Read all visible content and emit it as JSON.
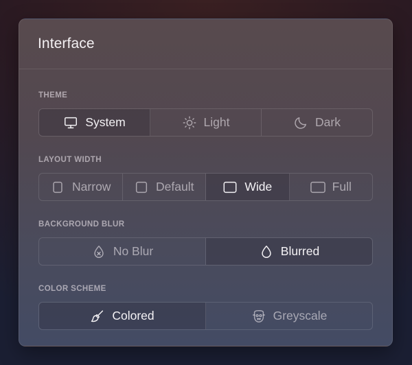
{
  "panel": {
    "title": "Interface"
  },
  "theme": {
    "label": "THEME",
    "options": [
      {
        "label": "System",
        "icon": "monitor-icon",
        "selected": true
      },
      {
        "label": "Light",
        "icon": "sun-icon",
        "selected": false
      },
      {
        "label": "Dark",
        "icon": "moon-icon",
        "selected": false
      }
    ]
  },
  "layout_width": {
    "label": "LAYOUT WIDTH",
    "options": [
      {
        "label": "Narrow",
        "icon": "checkbox-icon",
        "selected": false
      },
      {
        "label": "Default",
        "icon": "checkbox-icon",
        "selected": false
      },
      {
        "label": "Wide",
        "icon": "checkbox-icon",
        "selected": true
      },
      {
        "label": "Full",
        "icon": "checkbox-icon",
        "selected": false
      }
    ]
  },
  "background_blur": {
    "label": "BACKGROUND BLUR",
    "options": [
      {
        "label": "No Blur",
        "icon": "drop-off-icon",
        "selected": false
      },
      {
        "label": "Blurred",
        "icon": "drop-icon",
        "selected": true
      }
    ]
  },
  "color_scheme": {
    "label": "COLOR SCHEME",
    "options": [
      {
        "label": "Colored",
        "icon": "brush-icon",
        "selected": true
      },
      {
        "label": "Greyscale",
        "icon": "mask-icon",
        "selected": false
      }
    ]
  }
}
